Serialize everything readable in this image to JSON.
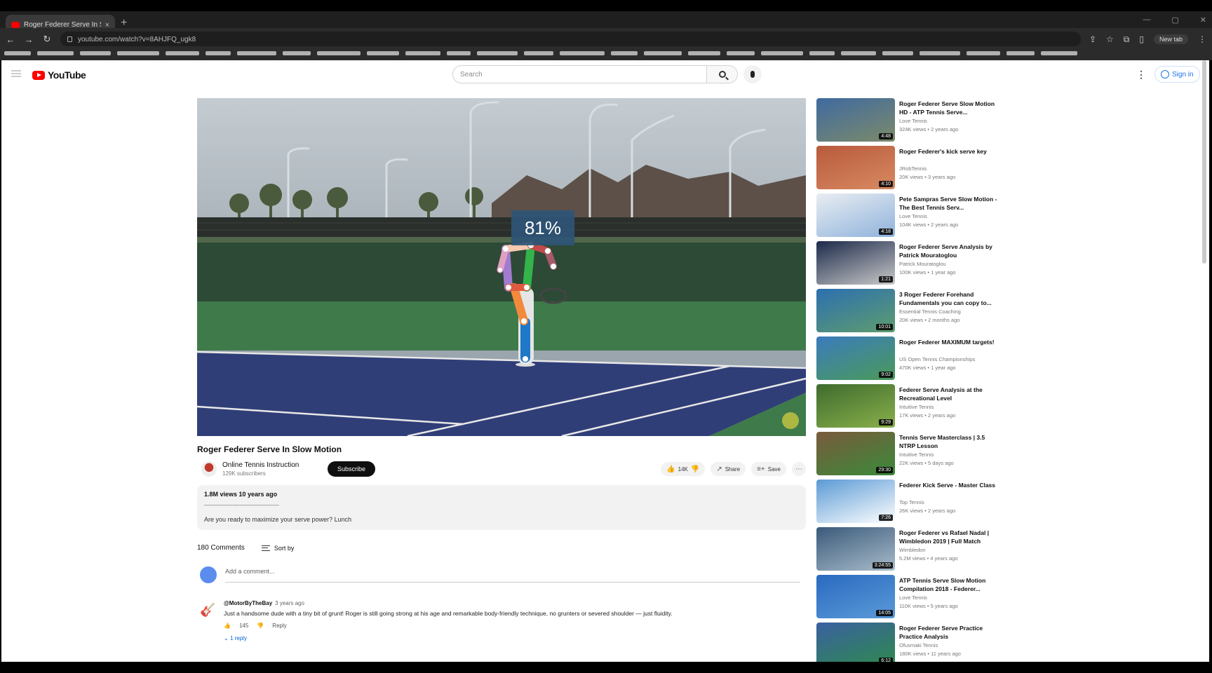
{
  "browser": {
    "tab_title": "Roger Federer Serve In Slow Motion",
    "tab_close": "×",
    "new_tab": "+",
    "url": "youtube.com/watch?v=8AHJFQ_ugk8",
    "profile_label": "New tab"
  },
  "masthead": {
    "logo_text": "YouTube",
    "search_placeholder": "Search",
    "signin_label": "Sign in"
  },
  "player": {
    "overlay_percent": "81%"
  },
  "video": {
    "title": "Roger Federer Serve In Slow Motion",
    "channel": "Online Tennis Instruction",
    "subscribers": "129K subscribers",
    "subscribe_label": "Subscribe",
    "like_count": "14K",
    "share_label": "Share",
    "save_label": "Save",
    "views_line": "1.8M views  10 years ago",
    "dashes": "— — — — — — — — — — — — —",
    "description": "Are you ready to maximize your serve power? Lunch"
  },
  "comments": {
    "count_label": "180 Comments",
    "sort_label": "Sort by",
    "add_placeholder": "Add a comment...",
    "items": [
      {
        "author": "@MotorByTheBay",
        "time": "3 years ago",
        "text": "Just a handsome dude with a tiny bit of grunt! Roger is still going strong at his age and remarkable body-friendly technique, no grunters or severed shoulder — just fluidity.",
        "likes": "145",
        "reply_label": "Reply",
        "replies_label": "1 reply"
      }
    ]
  },
  "recommendations": [
    {
      "title": "Roger Federer Serve Slow Motion HD - ATP Tennis Serve...",
      "channel": "Love Tennis",
      "meta": "324K views • 2 years ago",
      "duration": "4:48",
      "colors": [
        "#3f6aa0",
        "#7c8a6a"
      ]
    },
    {
      "title": "Roger Federer's kick serve key",
      "channel": "JRobTennis",
      "meta": "20K views • 3 years ago",
      "duration": "4:10",
      "colors": [
        "#b85a3c",
        "#d88a62"
      ]
    },
    {
      "title": "Pete Sampras Serve Slow Motion - The Best Tennis Serv...",
      "channel": "Love Tennis",
      "meta": "104K views • 2 years ago",
      "duration": "4:18",
      "colors": [
        "#e9edf2",
        "#8fb3dc"
      ]
    },
    {
      "title": "Roger Federer Serve Analysis by Patrick Mouratoglou",
      "channel": "Patrick Mouratoglou",
      "meta": "100K views • 1 year ago",
      "duration": "1:21",
      "colors": [
        "#1c2a4a",
        "#c9c9c9"
      ]
    },
    {
      "title": "3 Roger Federer Forehand Fundamentals you can copy to...",
      "channel": "Essential Tennis Coaching",
      "meta": "20K views • 2 months ago",
      "duration": "10:01",
      "colors": [
        "#2c6fb0",
        "#5e9d6e"
      ]
    },
    {
      "title": "Roger Federer MAXIMUM targets!",
      "channel": "US Open Tennis Championships",
      "meta": "470K views • 1 year ago",
      "duration": "9:02",
      "colors": [
        "#3b7bbd",
        "#4a9a5a"
      ]
    },
    {
      "title": "Federer Serve Analysis at the Recreational Level",
      "channel": "Intuitive Tennis",
      "meta": "17K views • 2 years ago",
      "duration": "9:29",
      "colors": [
        "#3d6b2e",
        "#8ab04a"
      ]
    },
    {
      "title": "Tennis Serve Masterclass | 3.5 NTRP Lesson",
      "channel": "Intuitive Tennis",
      "meta": "22K views • 5 days ago",
      "duration": "29:30",
      "colors": [
        "#7a5a3c",
        "#3a8a3a"
      ]
    },
    {
      "title": "Federer Kick Serve - Master Class",
      "channel": "Top Tennis",
      "meta": "26K views • 2 years ago",
      "duration": "7:26",
      "colors": [
        "#5b9ad5",
        "#ffffff"
      ]
    },
    {
      "title": "Roger Federer vs Rafael Nadal | Wimbledon 2019 | Full Match",
      "channel": "Wimbledon",
      "meta": "5.2M views • 4 years ago",
      "duration": "3:24:55",
      "colors": [
        "#3a5a7a",
        "#a9bccb"
      ]
    },
    {
      "title": "ATP Tennis Serve Slow Motion Compilation 2018 - Federer...",
      "channel": "Love Tennis",
      "meta": "110K views • 5 years ago",
      "duration": "14:05",
      "colors": [
        "#2a6ac0",
        "#5a9ad8"
      ]
    },
    {
      "title": "Roger Federer Serve Practice Practice Analysis",
      "channel": "Ofusmaki Tennis",
      "meta": "180K views • 11 years ago",
      "duration": "6:12",
      "colors": [
        "#3a60a0",
        "#2e8a4e"
      ]
    }
  ]
}
